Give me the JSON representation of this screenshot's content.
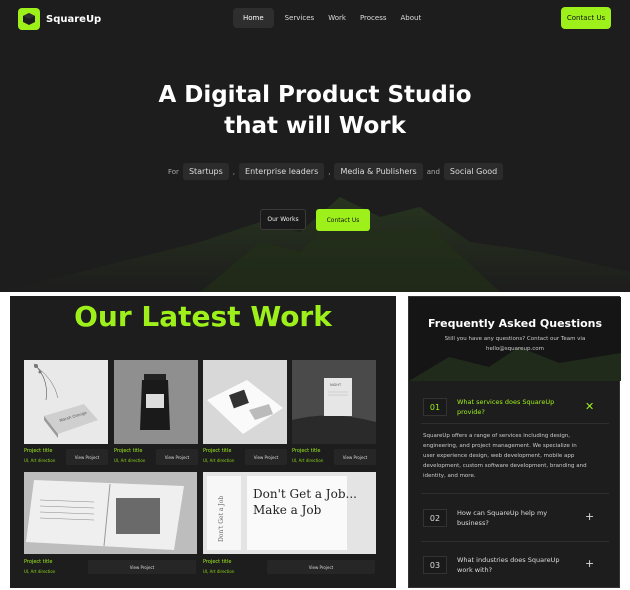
{
  "header": {
    "brand": "SquareUp",
    "nav": [
      "Home",
      "Services",
      "Work",
      "Process",
      "About"
    ],
    "contact_label": "Contact Us"
  },
  "hero": {
    "title_line1": "A Digital Product Studio",
    "title_line2": "that will Work",
    "for_label": "For",
    "audiences": [
      "Startups",
      "Enterprise leaders",
      "Media & Publishers",
      "Social Good"
    ],
    "and_label": "and",
    "sep": ",",
    "works_btn": "Our Works",
    "contact_btn": "Contact Us"
  },
  "work": {
    "title": "Our Latest Work",
    "projects": [
      {
        "title": "Project title",
        "sub": "UI, Art direction",
        "btn": "View Project"
      },
      {
        "title": "Project title",
        "sub": "UI, Art direction",
        "btn": "View Project"
      },
      {
        "title": "Project title",
        "sub": "UI, Art direction",
        "btn": "View Project"
      },
      {
        "title": "Project title",
        "sub": "UI, Art direction",
        "btn": "View Project"
      },
      {
        "title": "Project title",
        "sub": "UI, Art direction",
        "btn": "View Project"
      },
      {
        "title": "Project title",
        "sub": "UI, Art direction",
        "btn": "View Project"
      }
    ],
    "image_texts": {
      "book_cover": "Marsh Orange",
      "sauce_label": "",
      "paper": "NIGHT",
      "mag1": "Don't Get a Job...",
      "mag2": "Make a Job"
    }
  },
  "faq": {
    "title": "Frequently Asked Questions",
    "subtitle_line1": "Still you have any questions? Contact our Team via",
    "subtitle_line2": "hello@squareup.com",
    "items": [
      {
        "num": "01",
        "q_line1": "What services does SquareUp",
        "q_line2": "provide?",
        "icon": "close-icon"
      },
      {
        "num": "02",
        "q_line1": "How can SquareUp help my",
        "q_line2": "business?",
        "icon": "plus-icon"
      },
      {
        "num": "03",
        "q_line1": "What industries does SquareUp",
        "q_line2": "work with?",
        "icon": "plus-icon"
      }
    ],
    "answer_lines": [
      "SquareUp offers a range of services including design,",
      "engineering, and project management. We specialize in",
      "user experience design, web development, mobile app",
      "development, custom software development, branding and",
      "identity, and more."
    ]
  },
  "colors": {
    "accent": "#9ef01a",
    "bg": "#1d1d1d"
  }
}
